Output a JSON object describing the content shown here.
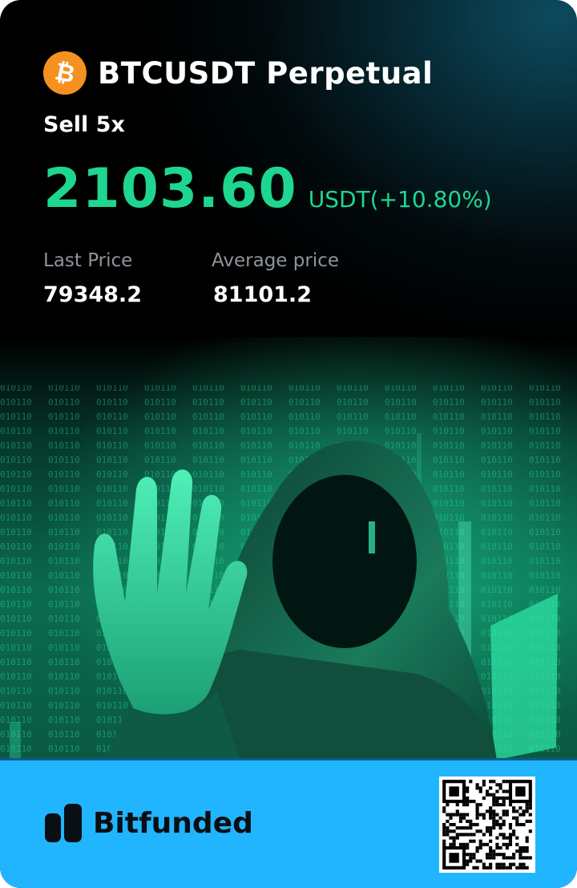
{
  "header": {
    "symbol_icon": "bitcoin-icon",
    "title": "BTCUSDT Perpetual"
  },
  "position": {
    "side": "Sell 5x",
    "pnl_value": "2103.60",
    "pnl_suffix": "USDT(+10.80%)"
  },
  "stats": {
    "last_price_label": "Last Price",
    "last_price_value": "79348.2",
    "average_price_label": "Average price",
    "average_price_value": "81101.2"
  },
  "footer": {
    "brand": "Bitfunded",
    "qr_icon": "qr-code-icon"
  },
  "colors": {
    "profit": "#1ed68f",
    "bitcoin": "#f5911e",
    "footer_bg": "#22b5ff"
  }
}
